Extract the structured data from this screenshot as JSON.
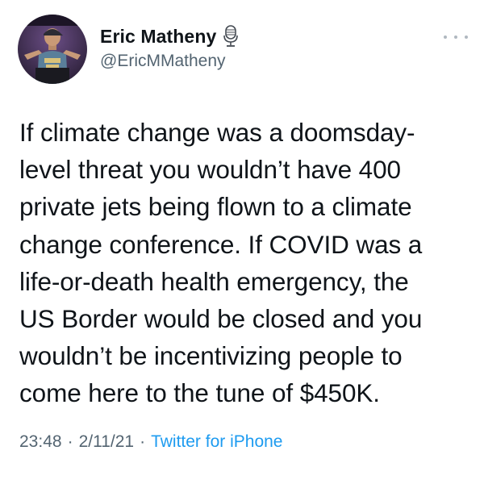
{
  "author": {
    "display_name": "Eric Matheny",
    "handle": "@EricMMatheny",
    "avatar_icon": "profile-photo",
    "badge_icon": "microphone-icon"
  },
  "tweet": {
    "text_lines": [
      "If climate change was a doomsday-",
      "level threat you wouldn’t have 400",
      "private jets being flown to a climate",
      "change conference. If COVID was a",
      "life-or-death health emergency, the",
      "US Border would be closed and you",
      "wouldn’t be incentivizing people to",
      "come here to the tune of $450K."
    ]
  },
  "meta": {
    "time": "23:48",
    "separator": "·",
    "date": "2/11/21",
    "source": "Twitter for iPhone"
  },
  "colors": {
    "text": "#0f1419",
    "secondary": "#536471",
    "link": "#1d9bf0",
    "background": "#ffffff"
  }
}
